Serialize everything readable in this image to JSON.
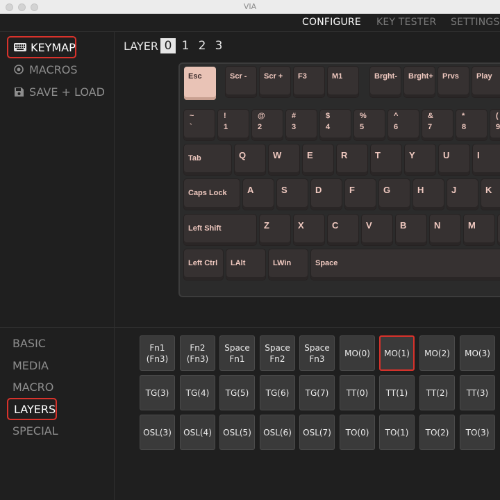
{
  "window": {
    "title": "VIA"
  },
  "topnav": {
    "tabs": [
      "CONFIGURE",
      "KEY TESTER",
      "SETTINGS"
    ],
    "active": "CONFIGURE"
  },
  "sidebar": {
    "items": [
      {
        "label": "KEYMAP",
        "icon": "keyboard-icon",
        "active": true
      },
      {
        "label": "MACROS",
        "icon": "record-circle-icon",
        "active": false
      },
      {
        "label": "SAVE + LOAD",
        "icon": "floppy-disk-icon",
        "active": false
      }
    ]
  },
  "categories": {
    "items": [
      "BASIC",
      "MEDIA",
      "MACRO",
      "LAYERS",
      "SPECIAL"
    ],
    "active": "LAYERS"
  },
  "layers": {
    "label": "LAYER",
    "numbers": [
      "0",
      "1",
      "2",
      "3"
    ],
    "active": "0"
  },
  "keyboard": {
    "row1": [
      "Esc",
      "Scr -",
      "Scr +",
      "F3",
      "M1",
      "Brght-",
      "Brght+",
      "Prvs",
      "Play"
    ],
    "row2": [
      {
        "top": "~",
        "bottom": "`"
      },
      {
        "top": "!",
        "bottom": "1"
      },
      {
        "top": "@",
        "bottom": "2"
      },
      {
        "top": "#",
        "bottom": "3"
      },
      {
        "top": "$",
        "bottom": "4"
      },
      {
        "top": "%",
        "bottom": "5"
      },
      {
        "top": "^",
        "bottom": "6"
      },
      {
        "top": "&",
        "bottom": "7"
      },
      {
        "top": "*",
        "bottom": "8"
      },
      {
        "top": "(",
        "bottom": "9"
      }
    ],
    "row3": [
      "Tab",
      "Q",
      "W",
      "E",
      "R",
      "T",
      "Y",
      "U",
      "I"
    ],
    "row4": [
      "Caps Lock",
      "A",
      "S",
      "D",
      "F",
      "G",
      "H",
      "J",
      "K"
    ],
    "row5": [
      "Left Shift",
      "Z",
      "X",
      "C",
      "V",
      "B",
      "N",
      "M"
    ],
    "row6": [
      "Left Ctrl",
      "LAlt",
      "LWin",
      "Space"
    ]
  },
  "keycodes": {
    "rows": [
      [
        "Fn1\n(Fn3)",
        "Fn2\n(Fn3)",
        "Space\nFn1",
        "Space\nFn2",
        "Space\nFn3",
        "MO(0)",
        "MO(1)",
        "MO(2)",
        "MO(3)"
      ],
      [
        "TG(3)",
        "TG(4)",
        "TG(5)",
        "TG(6)",
        "TG(7)",
        "TT(0)",
        "TT(1)",
        "TT(2)",
        "TT(3)"
      ],
      [
        "OSL(3)",
        "OSL(4)",
        "OSL(5)",
        "OSL(6)",
        "OSL(7)",
        "TO(0)",
        "TO(1)",
        "TO(2)",
        "TO(3)"
      ]
    ],
    "selected": "MO(1)"
  },
  "colors": {
    "accent_highlight": "#d8322b",
    "keycap_legend": "#f0c9c0",
    "esc_key": "#e9c3b6"
  }
}
